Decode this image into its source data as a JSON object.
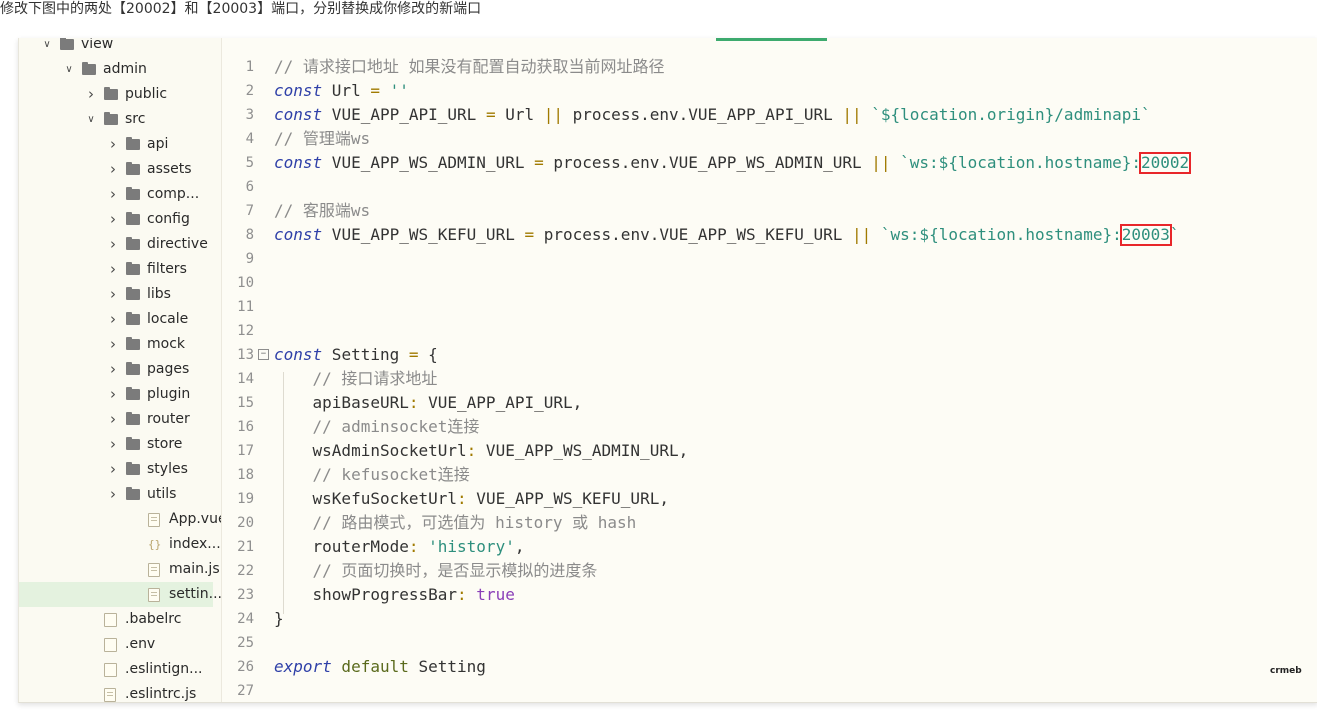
{
  "instruction": "修改下图中的两处【20002】和【20003】端口，分别替换成你修改的新端口",
  "watermark": "crmeb",
  "tree": [
    {
      "label": "view",
      "kind": "folder",
      "expanded": true,
      "depth": 1
    },
    {
      "label": "admin",
      "kind": "folder",
      "expanded": true,
      "depth": 2
    },
    {
      "label": "public",
      "kind": "folder",
      "expanded": false,
      "depth": 3
    },
    {
      "label": "src",
      "kind": "folder",
      "expanded": true,
      "depth": 3
    },
    {
      "label": "api",
      "kind": "folder",
      "expanded": false,
      "depth": 4
    },
    {
      "label": "assets",
      "kind": "folder",
      "expanded": false,
      "depth": 4
    },
    {
      "label": "comp...",
      "kind": "folder",
      "expanded": false,
      "depth": 4
    },
    {
      "label": "config",
      "kind": "folder",
      "expanded": false,
      "depth": 4
    },
    {
      "label": "directive",
      "kind": "folder",
      "expanded": false,
      "depth": 4
    },
    {
      "label": "filters",
      "kind": "folder",
      "expanded": false,
      "depth": 4
    },
    {
      "label": "libs",
      "kind": "folder",
      "expanded": false,
      "depth": 4
    },
    {
      "label": "locale",
      "kind": "folder",
      "expanded": false,
      "depth": 4
    },
    {
      "label": "mock",
      "kind": "folder",
      "expanded": false,
      "depth": 4
    },
    {
      "label": "pages",
      "kind": "folder",
      "expanded": false,
      "depth": 4
    },
    {
      "label": "plugin",
      "kind": "folder",
      "expanded": false,
      "depth": 4
    },
    {
      "label": "router",
      "kind": "folder",
      "expanded": false,
      "depth": 4
    },
    {
      "label": "store",
      "kind": "folder",
      "expanded": false,
      "depth": 4
    },
    {
      "label": "styles",
      "kind": "folder",
      "expanded": false,
      "depth": 4
    },
    {
      "label": "utils",
      "kind": "folder",
      "expanded": false,
      "depth": 4
    },
    {
      "label": "App.vue",
      "kind": "file",
      "depth": 5
    },
    {
      "label": "index....",
      "kind": "braces",
      "depth": 5
    },
    {
      "label": "main.js",
      "kind": "file",
      "depth": 5
    },
    {
      "label": "settin...",
      "kind": "file",
      "depth": 5,
      "selected": true
    },
    {
      "label": ".babelrc",
      "kind": "blank",
      "depth": 3
    },
    {
      "label": ".env",
      "kind": "blank",
      "depth": 3
    },
    {
      "label": ".eslintign...",
      "kind": "blank",
      "depth": 3
    },
    {
      "label": ".eslintrc.js",
      "kind": "file",
      "depth": 3
    }
  ],
  "code_lines": [
    {
      "n": "1",
      "tokens": [
        [
          "cmt",
          "// 请求接口地址 如果没有配置自动获取当前网址路径"
        ]
      ]
    },
    {
      "n": "2",
      "tokens": [
        [
          "kw",
          "const"
        ],
        [
          "id",
          " Url "
        ],
        [
          "op",
          "="
        ],
        [
          "str",
          " ''"
        ]
      ]
    },
    {
      "n": "3",
      "tokens": [
        [
          "kw",
          "const"
        ],
        [
          "id",
          " VUE_APP_API_URL "
        ],
        [
          "op",
          "="
        ],
        [
          "id",
          " Url "
        ],
        [
          "op",
          "||"
        ],
        [
          "id",
          " process.env.VUE_APP_API_URL "
        ],
        [
          "op",
          "||"
        ],
        [
          "str",
          " `${location.origin}/adminapi`"
        ]
      ]
    },
    {
      "n": "4",
      "tokens": [
        [
          "cmt",
          "// 管理端ws"
        ]
      ]
    },
    {
      "n": "5",
      "tokens": [
        [
          "kw",
          "const"
        ],
        [
          "id",
          " VUE_APP_WS_ADMIN_URL "
        ],
        [
          "op",
          "="
        ],
        [
          "id",
          " process.env.VUE_APP_WS_ADMIN_URL "
        ],
        [
          "op",
          "||"
        ],
        [
          "str",
          " `ws:${location.hostname}:"
        ],
        [
          "port",
          "20002"
        ]
      ]
    },
    {
      "n": "6",
      "tokens": []
    },
    {
      "n": "7",
      "tokens": [
        [
          "cmt",
          "// 客服端ws"
        ]
      ]
    },
    {
      "n": "8",
      "tokens": [
        [
          "kw",
          "const"
        ],
        [
          "id",
          " VUE_APP_WS_KEFU_URL "
        ],
        [
          "op",
          "="
        ],
        [
          "id",
          " process.env.VUE_APP_WS_KEFU_URL "
        ],
        [
          "op",
          "||"
        ],
        [
          "str",
          " `ws:${location.hostname}:"
        ],
        [
          "port",
          "20003"
        ],
        [
          "str",
          "`"
        ]
      ]
    },
    {
      "n": "9",
      "tokens": []
    },
    {
      "n": "10",
      "tokens": []
    },
    {
      "n": "11",
      "tokens": []
    },
    {
      "n": "12",
      "tokens": []
    },
    {
      "n": "13",
      "fold": "⊟",
      "tokens": [
        [
          "kw",
          "const"
        ],
        [
          "id",
          " Setting "
        ],
        [
          "op",
          "="
        ],
        [
          "id",
          " {"
        ]
      ]
    },
    {
      "n": "14",
      "tokens": [
        [
          "cmt",
          "    // 接口请求地址"
        ]
      ]
    },
    {
      "n": "15",
      "tokens": [
        [
          "id",
          "    apiBaseURL"
        ],
        [
          "op",
          ":"
        ],
        [
          "id",
          " VUE_APP_API_URL,"
        ]
      ]
    },
    {
      "n": "16",
      "tokens": [
        [
          "cmt",
          "    // adminsocket连接"
        ]
      ]
    },
    {
      "n": "17",
      "tokens": [
        [
          "id",
          "    wsAdminSocketUrl"
        ],
        [
          "op",
          ":"
        ],
        [
          "id",
          " VUE_APP_WS_ADMIN_URL,"
        ]
      ]
    },
    {
      "n": "18",
      "tokens": [
        [
          "cmt",
          "    // kefusocket连接"
        ]
      ]
    },
    {
      "n": "19",
      "tokens": [
        [
          "id",
          "    wsKefuSocketUrl"
        ],
        [
          "op",
          ":"
        ],
        [
          "id",
          " VUE_APP_WS_KEFU_URL,"
        ]
      ]
    },
    {
      "n": "20",
      "tokens": [
        [
          "cmt",
          "    // 路由模式，可选值为 history 或 hash"
        ]
      ]
    },
    {
      "n": "21",
      "tokens": [
        [
          "id",
          "    routerMode"
        ],
        [
          "op",
          ":"
        ],
        [
          "str",
          " 'history'"
        ],
        [
          "id",
          ","
        ]
      ]
    },
    {
      "n": "22",
      "tokens": [
        [
          "cmt",
          "    // 页面切换时，是否显示模拟的进度条"
        ]
      ]
    },
    {
      "n": "23",
      "tokens": [
        [
          "id",
          "    showProgressBar"
        ],
        [
          "op",
          ":"
        ],
        [
          "bool",
          " true"
        ]
      ]
    },
    {
      "n": "24",
      "tokens": [
        [
          "id",
          "}"
        ]
      ]
    },
    {
      "n": "25",
      "tokens": []
    },
    {
      "n": "26",
      "tokens": [
        [
          "kw",
          "export"
        ],
        [
          "kw2",
          " default"
        ],
        [
          "id",
          " Setting"
        ]
      ]
    },
    {
      "n": "27",
      "tokens": []
    }
  ]
}
